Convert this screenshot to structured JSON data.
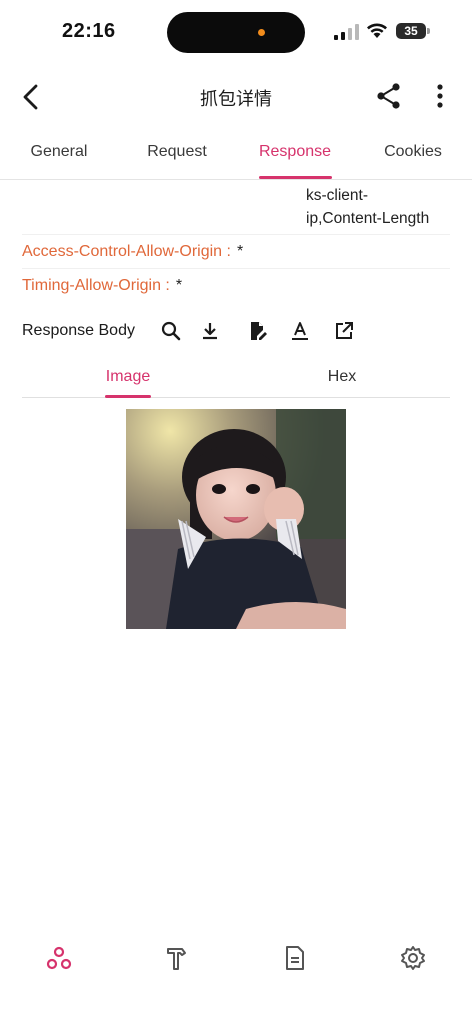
{
  "status_bar": {
    "time": "22:16",
    "battery": "35"
  },
  "app_bar": {
    "title": "抓包详情"
  },
  "tabs": [
    {
      "label": "General",
      "active": false
    },
    {
      "label": "Request",
      "active": false
    },
    {
      "label": "Response",
      "active": true
    },
    {
      "label": "Cookies",
      "active": false
    }
  ],
  "headers": {
    "continued_value_lines": [
      "ks-client-",
      "ip,Content-Length"
    ],
    "rows": [
      {
        "key": "Access-Control-Allow-Origin :",
        "value": "*"
      },
      {
        "key": "Timing-Allow-Origin :",
        "value": "*"
      }
    ]
  },
  "response_body": {
    "label": "Response Body",
    "tools": [
      "search-icon",
      "download-icon",
      "edit-file-icon",
      "text-format-icon",
      "open-external-icon"
    ],
    "subtabs": [
      {
        "label": "Image",
        "active": true
      },
      {
        "label": "Hex",
        "active": false
      }
    ]
  },
  "bottom_nav": [
    "network-icon",
    "hammer-icon",
    "document-icon",
    "settings-icon"
  ],
  "colors": {
    "accent": "#d6336c",
    "header_key": "#e0683a",
    "text": "#1b1b1b"
  }
}
